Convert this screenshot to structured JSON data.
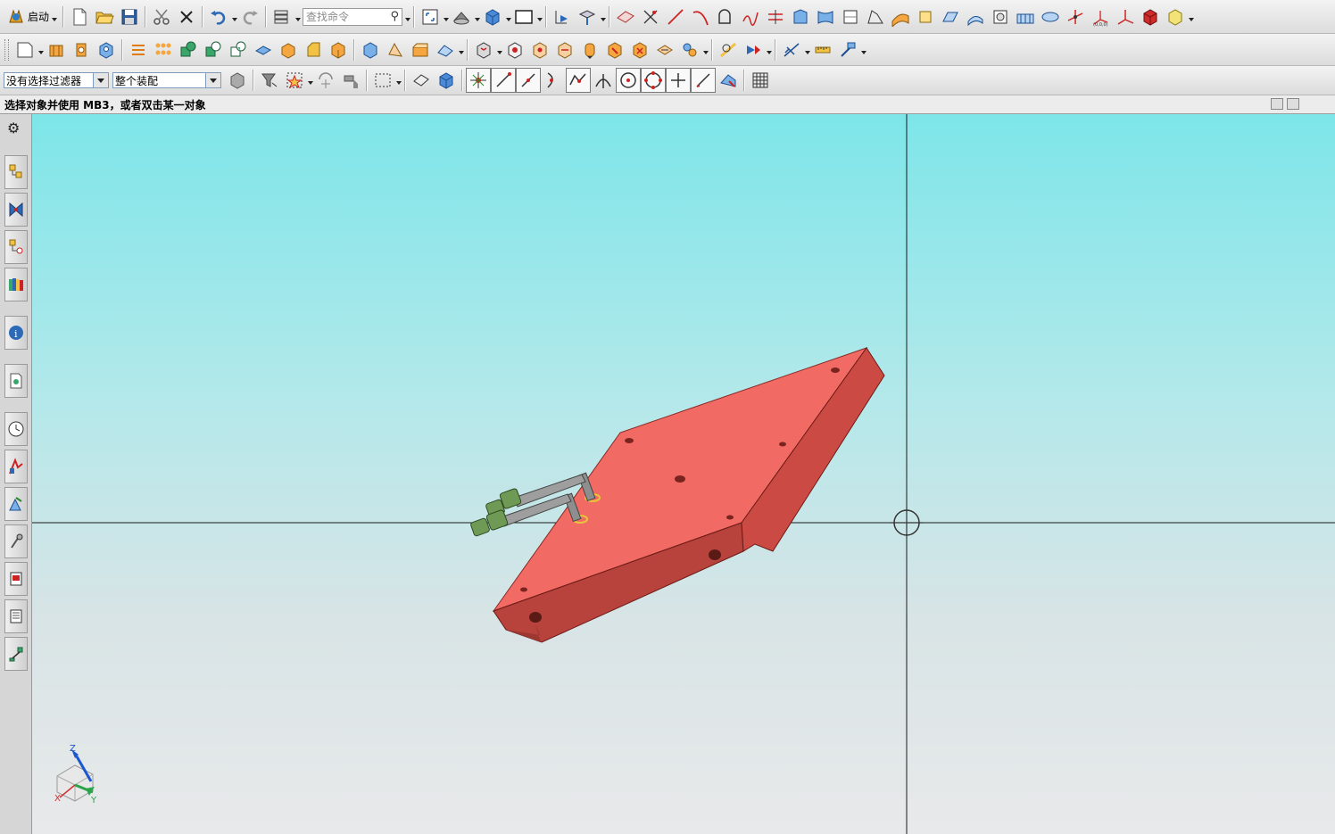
{
  "toolbar": {
    "start_label": "启动",
    "search_placeholder": "查找命令"
  },
  "selection_bar": {
    "type_filter": "没有选择过滤器",
    "scope": "整个装配"
  },
  "cue_line": {
    "text": "选择对象并使用 MB3，或者双击某一对象"
  },
  "view_triad": {
    "x": "X",
    "y": "Y",
    "z": "Z"
  },
  "colors": {
    "viewport_top": "#7de6e9",
    "viewport_bottom": "#e8e9ea",
    "part_top_face": "#f26a64",
    "part_side_face": "#b8423c",
    "fitting_green": "#6f9a55",
    "rod_grey": "#8e8e8e"
  },
  "icons": {
    "row1": [
      "new-file-icon",
      "open-folder-icon",
      "save-icon",
      "cut-icon",
      "delete-icon",
      "undo-icon",
      "redo-icon",
      "layer-settings-icon",
      "fit-view-icon",
      "render-style-icon",
      "cube-view-icon",
      "rectangle-view-icon",
      "orient-icon",
      "snap-view-icon",
      "datum-plane-icon",
      "point-icon",
      "line-icon",
      "arc-icon",
      "sketch-profile-icon",
      "curve-icon",
      "project-curve-icon",
      "extrude-curve-icon",
      "surface-icon",
      "swept-icon",
      "ruled-icon",
      "through-curves-icon",
      "offset-surface-icon",
      "sew-icon",
      "mesh-surface-icon",
      "tube-icon",
      "tree-icon",
      "wcs-icon",
      "csys-icon",
      "solid-box-icon",
      "feature-icon"
    ],
    "row2": [
      "new-part-icon",
      "extrude-icon",
      "revolve-icon",
      "hole-icon",
      "pattern-icon",
      "array-icon",
      "unite-icon",
      "subtract-icon",
      "intersect-icon",
      "trim-body-icon",
      "offset-face-icon",
      "chamfer-icon",
      "blend-icon",
      "shell-icon",
      "draft-icon",
      "pad-icon",
      "assembly-icon",
      "add-component-icon",
      "mate-icon",
      "move-component-icon",
      "explode-icon",
      "cut-section-icon",
      "reposition-icon",
      "measure-distance-icon",
      "measure-angle-icon",
      "analysis-icon",
      "simulation-icon",
      "measure-ruler-icon",
      "wave-icon"
    ],
    "row3": [
      "type-filter-icon",
      "filter-funnel-icon",
      "select-all-icon",
      "snap-icon",
      "deselect-icon",
      "rectangle-select-icon",
      "face-select-icon",
      "body-select-icon",
      "snap-point-icon",
      "endpoint-snap-icon",
      "midpoint-snap-icon",
      "control-point-icon",
      "curve-on-curve-icon",
      "intersection-icon",
      "center-snap-icon",
      "quadrant-icon",
      "existing-point-icon",
      "point-on-curve-icon",
      "point-on-face-icon",
      "grid-icon"
    ]
  }
}
